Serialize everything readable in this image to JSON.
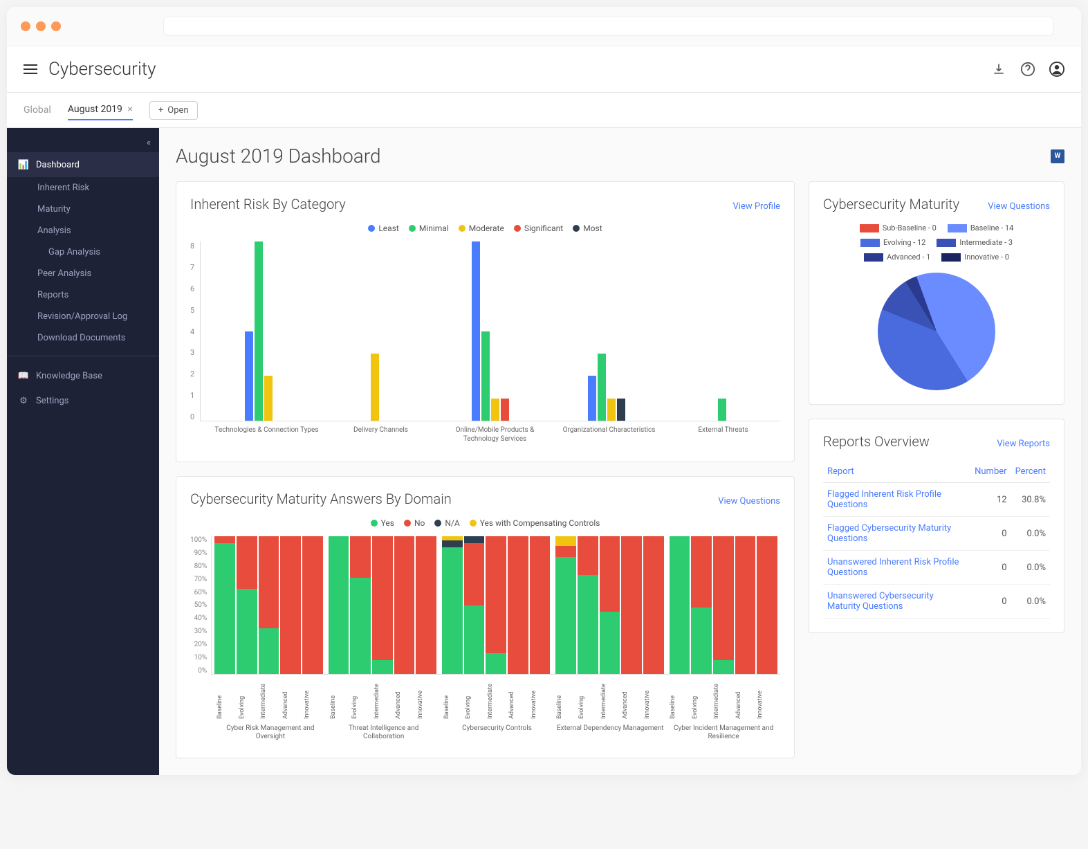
{
  "header": {
    "title": "Cybersecurity",
    "tabs": [
      "Global",
      "August 2019"
    ],
    "active_tab": 1,
    "open_label": "Open"
  },
  "sidebar": {
    "items": [
      {
        "label": "Dashboard",
        "active": true,
        "icon": "chart"
      },
      {
        "label": "Inherent Risk",
        "sub": true
      },
      {
        "label": "Maturity",
        "sub": true
      },
      {
        "label": "Analysis",
        "sub": true
      },
      {
        "label": "Gap Analysis",
        "sub2": true
      },
      {
        "label": "Peer Analysis",
        "sub": true
      },
      {
        "label": "Reports",
        "sub": true
      },
      {
        "label": "Revision/Approval Log",
        "sub": true
      },
      {
        "label": "Download Documents",
        "sub": true
      }
    ],
    "bottom": [
      {
        "label": "Knowledge Base",
        "icon": "book"
      },
      {
        "label": "Settings",
        "icon": "gear"
      }
    ]
  },
  "page": {
    "title": "August 2019 Dashboard"
  },
  "risk_card": {
    "title": "Inherent Risk By Category",
    "link": "View Profile"
  },
  "maturity_card": {
    "title": "Cybersecurity Maturity",
    "link": "View Questions"
  },
  "reports_card": {
    "title": "Reports Overview",
    "link": "View Reports",
    "headers": [
      "Report",
      "Number",
      "Percent"
    ],
    "rows": [
      {
        "name": "Flagged Inherent Risk Profile Questions",
        "num": "12",
        "pct": "30.8%"
      },
      {
        "name": "Flagged Cybersecurity Maturity Questions",
        "num": "0",
        "pct": "0.0%"
      },
      {
        "name": "Unanswered Inherent Risk Profile Questions",
        "num": "0",
        "pct": "0.0%"
      },
      {
        "name": "Unanswered Cybersecurity Maturity Questions",
        "num": "0",
        "pct": "0.0%"
      }
    ]
  },
  "domain_card": {
    "title": "Cybersecurity Maturity Answers By Domain",
    "link": "View Questions"
  },
  "colors": {
    "least": "#4a7cff",
    "minimal": "#2ecc71",
    "moderate": "#f1c40f",
    "significant": "#e74c3c",
    "most": "#2c3e50",
    "yes": "#2ecc71",
    "no": "#e74c3c",
    "na": "#2c3e50",
    "yescc": "#f1c40f",
    "sub_baseline": "#e74c3c",
    "baseline": "#6b8cff",
    "evolving": "#4a6bdd",
    "intermediate": "#3a52b5",
    "advanced": "#2a3a8f",
    "innovative": "#1a2560"
  },
  "chart_data": [
    {
      "id": "inherent_risk",
      "type": "bar",
      "title": "Inherent Risk By Category",
      "ylim": [
        0,
        8
      ],
      "ticks": [
        0,
        1,
        2,
        3,
        4,
        5,
        6,
        7,
        8
      ],
      "legend": [
        "Least",
        "Minimal",
        "Moderate",
        "Significant",
        "Most"
      ],
      "categories": [
        "Technologies & Connection Types",
        "Delivery Channels",
        "Online/Mobile Products & Technology Services",
        "Organizational Characteristics",
        "External Threats"
      ],
      "series": [
        {
          "name": "Least",
          "values": [
            4,
            0,
            8,
            2,
            0
          ]
        },
        {
          "name": "Minimal",
          "values": [
            8,
            0,
            4,
            3,
            1
          ]
        },
        {
          "name": "Moderate",
          "values": [
            2,
            3,
            1,
            1,
            0
          ]
        },
        {
          "name": "Significant",
          "values": [
            0,
            0,
            1,
            0,
            0
          ]
        },
        {
          "name": "Most",
          "values": [
            0,
            0,
            0,
            1,
            0
          ]
        }
      ]
    },
    {
      "id": "maturity_pie",
      "type": "pie",
      "title": "Cybersecurity Maturity",
      "slices": [
        {
          "name": "Sub-Baseline",
          "value": 0
        },
        {
          "name": "Baseline",
          "value": 14
        },
        {
          "name": "Evolving",
          "value": 12
        },
        {
          "name": "Intermediate",
          "value": 3
        },
        {
          "name": "Advanced",
          "value": 1
        },
        {
          "name": "Innovative",
          "value": 0
        }
      ]
    },
    {
      "id": "maturity_by_domain",
      "type": "stacked-bar-pct",
      "title": "Cybersecurity Maturity Answers By Domain",
      "ylim": [
        0,
        100
      ],
      "legend": [
        "Yes",
        "No",
        "N/A",
        "Yes with Compensating Controls"
      ],
      "levels": [
        "Baseline",
        "Evolving",
        "Intermediate",
        "Advanced",
        "Innovative"
      ],
      "domains": [
        "Cyber Risk Management and Oversight",
        "Threat Intelligence and Collaboration",
        "Cybersecurity Controls",
        "External Dependency Management",
        "Cyber Incident Management and Resilience"
      ],
      "data": {
        "Cyber Risk Management and Oversight": {
          "Baseline": {
            "Yes": 95,
            "No": 5,
            "N/A": 0,
            "Yes with Compensating Controls": 0
          },
          "Evolving": {
            "Yes": 62,
            "No": 38,
            "N/A": 0,
            "Yes with Compensating Controls": 0
          },
          "Intermediate": {
            "Yes": 33,
            "No": 67,
            "N/A": 0,
            "Yes with Compensating Controls": 0
          },
          "Advanced": {
            "Yes": 0,
            "No": 100,
            "N/A": 0,
            "Yes with Compensating Controls": 0
          },
          "Innovative": {
            "Yes": 0,
            "No": 100,
            "N/A": 0,
            "Yes with Compensating Controls": 0
          }
        },
        "Threat Intelligence and Collaboration": {
          "Baseline": {
            "Yes": 100,
            "No": 0,
            "N/A": 0,
            "Yes with Compensating Controls": 0
          },
          "Evolving": {
            "Yes": 70,
            "No": 30,
            "N/A": 0,
            "Yes with Compensating Controls": 0
          },
          "Intermediate": {
            "Yes": 10,
            "No": 90,
            "N/A": 0,
            "Yes with Compensating Controls": 0
          },
          "Advanced": {
            "Yes": 0,
            "No": 100,
            "N/A": 0,
            "Yes with Compensating Controls": 0
          },
          "Innovative": {
            "Yes": 0,
            "No": 100,
            "N/A": 0,
            "Yes with Compensating Controls": 0
          }
        },
        "Cybersecurity Controls": {
          "Baseline": {
            "Yes": 92,
            "No": 0,
            "N/A": 5,
            "Yes with Compensating Controls": 3
          },
          "Evolving": {
            "Yes": 50,
            "No": 45,
            "N/A": 5,
            "Yes with Compensating Controls": 0
          },
          "Intermediate": {
            "Yes": 15,
            "No": 85,
            "N/A": 0,
            "Yes with Compensating Controls": 0
          },
          "Advanced": {
            "Yes": 0,
            "No": 100,
            "N/A": 0,
            "Yes with Compensating Controls": 0
          },
          "Innovative": {
            "Yes": 0,
            "No": 100,
            "N/A": 0,
            "Yes with Compensating Controls": 0
          }
        },
        "External Dependency Management": {
          "Baseline": {
            "Yes": 85,
            "No": 8,
            "N/A": 0,
            "Yes with Compensating Controls": 7
          },
          "Evolving": {
            "Yes": 72,
            "No": 28,
            "N/A": 0,
            "Yes with Compensating Controls": 0
          },
          "Intermediate": {
            "Yes": 45,
            "No": 55,
            "N/A": 0,
            "Yes with Compensating Controls": 0
          },
          "Advanced": {
            "Yes": 0,
            "No": 100,
            "N/A": 0,
            "Yes with Compensating Controls": 0
          },
          "Innovative": {
            "Yes": 0,
            "No": 100,
            "N/A": 0,
            "Yes with Compensating Controls": 0
          }
        },
        "Cyber Incident Management and Resilience": {
          "Baseline": {
            "Yes": 100,
            "No": 0,
            "N/A": 0,
            "Yes with Compensating Controls": 0
          },
          "Evolving": {
            "Yes": 48,
            "No": 52,
            "N/A": 0,
            "Yes with Compensating Controls": 0
          },
          "Intermediate": {
            "Yes": 10,
            "No": 90,
            "N/A": 0,
            "Yes with Compensating Controls": 0
          },
          "Advanced": {
            "Yes": 0,
            "No": 100,
            "N/A": 0,
            "Yes with Compensating Controls": 0
          },
          "Innovative": {
            "Yes": 0,
            "No": 100,
            "N/A": 0,
            "Yes with Compensating Controls": 0
          }
        }
      }
    }
  ]
}
